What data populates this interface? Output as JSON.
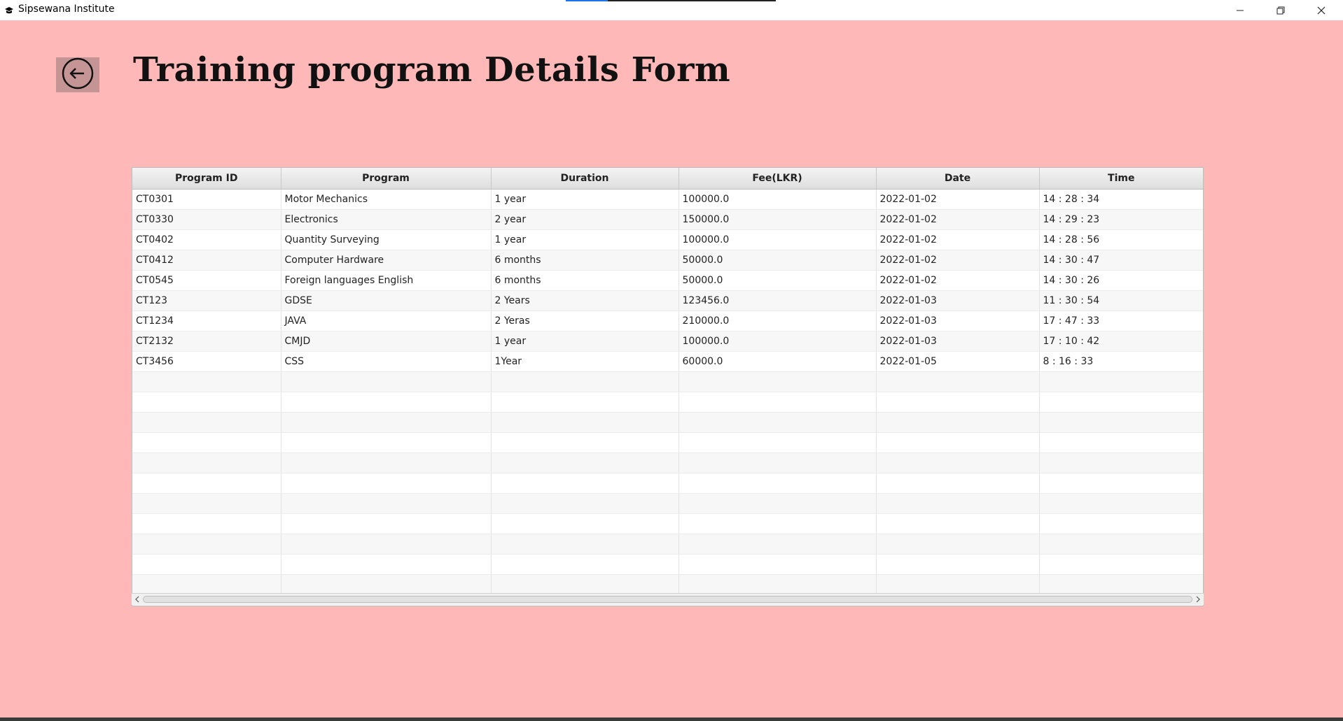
{
  "window": {
    "title": "Sipsewana Institute",
    "minimize_icon": "minimize-icon",
    "maximize_icon": "restore-icon",
    "close_icon": "close-icon"
  },
  "page": {
    "title": "Training program Details Form",
    "back_icon": "arrow-left-circle-icon"
  },
  "table": {
    "columns": [
      "Program ID",
      "Program",
      "Duration",
      "Fee(LKR)",
      "Date",
      "Time"
    ],
    "rows": [
      [
        "CT0301",
        "Motor Mechanics",
        "1 year",
        "100000.0",
        "2022-01-02",
        "14 : 28 : 34"
      ],
      [
        "CT0330",
        "Electronics",
        "2 year",
        "150000.0",
        "2022-01-02",
        "14 : 29 : 23"
      ],
      [
        "CT0402",
        "Quantity Surveying",
        "1 year",
        "100000.0",
        "2022-01-02",
        "14 : 28 : 56"
      ],
      [
        "CT0412",
        "Computer Hardware",
        "6 months",
        "50000.0",
        "2022-01-02",
        "14 : 30 : 47"
      ],
      [
        "CT0545",
        "Foreign languages English",
        "6 months",
        "50000.0",
        "2022-01-02",
        "14 : 30 : 26"
      ],
      [
        "CT123",
        "GDSE",
        "2 Years",
        "123456.0",
        "2022-01-03",
        "11 : 30 : 54"
      ],
      [
        "CT1234",
        "JAVA",
        "2 Yeras",
        "210000.0",
        "2022-01-03",
        "17 : 47 : 33"
      ],
      [
        "CT2132",
        "CMJD",
        "1 year",
        "100000.0",
        "2022-01-03",
        "17 : 10 : 42"
      ],
      [
        "CT3456",
        "CSS",
        "1Year",
        "60000.0",
        "2022-01-05",
        "8 : 16 : 33"
      ]
    ]
  },
  "colors": {
    "background": "#ffb8b8",
    "back_button": "#c59596"
  }
}
